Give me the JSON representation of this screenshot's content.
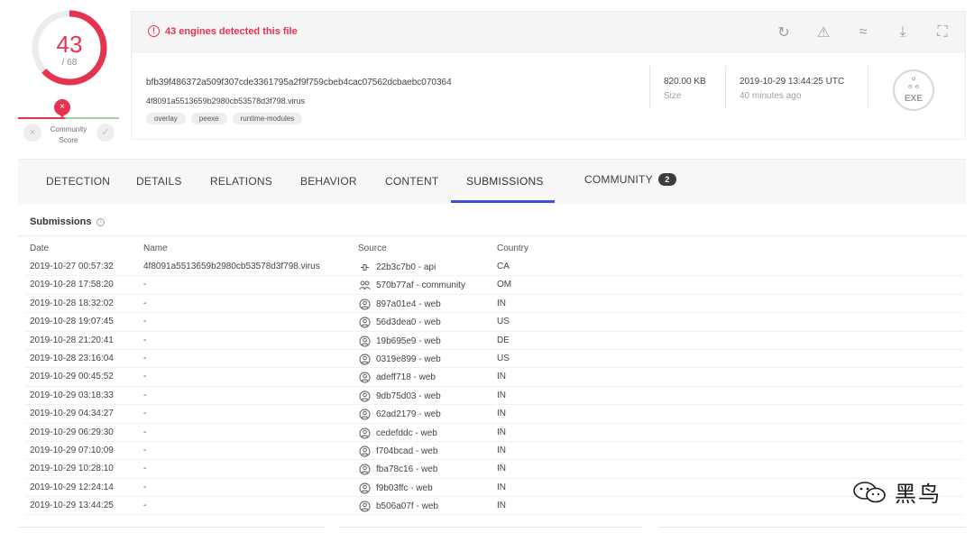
{
  "score": {
    "detected": "43",
    "total": "/ 68",
    "community_label_line1": "Community",
    "community_label_line2": "Score",
    "community_pin": "×",
    "dislike": "×",
    "like": "✓"
  },
  "alert": {
    "text": "43 engines detected this file",
    "icon": "!"
  },
  "tools": [
    {
      "name": "reanalyze-icon",
      "glyph": "↻"
    },
    {
      "name": "similar-icon",
      "glyph": "⚠"
    },
    {
      "name": "graph-icon",
      "glyph": "≈"
    },
    {
      "name": "download-icon",
      "glyph": "⤓"
    },
    {
      "name": "expand-icon",
      "glyph": "⛶"
    }
  ],
  "file": {
    "hash": "bfb39f486372a509f307cde3361795a2f9f759cbeb4cac07562dcbaebc070364",
    "name": "4f8091a5513659b2980cb53578d3f798.virus",
    "tags": [
      "overlay",
      "peexe",
      "runtime-modules"
    ],
    "size": "820.00 KB",
    "size_label": "Size",
    "date": "2019-10-29 13:44:25 UTC",
    "date_relative": "40 minutes ago",
    "type_icon_text": "EXE",
    "type_icon_glyph": "ஃ"
  },
  "tabs": [
    {
      "label": "DETECTION"
    },
    {
      "label": "DETAILS"
    },
    {
      "label": "RELATIONS"
    },
    {
      "label": "BEHAVIOR"
    },
    {
      "label": "CONTENT"
    },
    {
      "label": "SUBMISSIONS"
    },
    {
      "label": "COMMUNITY",
      "badge": "2"
    }
  ],
  "submissions": {
    "title": "Submissions",
    "info_icon": "i",
    "columns": {
      "date": "Date",
      "name": "Name",
      "source": "Source",
      "country": "Country"
    },
    "rows": [
      {
        "date": "2019-10-27 00:57:32",
        "name": "4f8091a5513659b2980cb53578d3f798.virus",
        "source": "22b3c7b0 - api",
        "type": "api",
        "country": "CA"
      },
      {
        "date": "2019-10-28 17:58:20",
        "name": "-",
        "source": "570b77af - community",
        "type": "community",
        "country": "OM"
      },
      {
        "date": "2019-10-28 18:32:02",
        "name": "-",
        "source": "897a01e4 - web",
        "type": "web",
        "country": "IN"
      },
      {
        "date": "2019-10-28 19:07:45",
        "name": "-",
        "source": "56d3dea0 - web",
        "type": "web",
        "country": "US"
      },
      {
        "date": "2019-10-28 21:20:41",
        "name": "-",
        "source": "19b695e9 - web",
        "type": "web",
        "country": "DE"
      },
      {
        "date": "2019-10-28 23:16:04",
        "name": "-",
        "source": "0319e899 - web",
        "type": "web",
        "country": "US"
      },
      {
        "date": "2019-10-29 00:45:52",
        "name": "-",
        "source": "adeff718 - web",
        "type": "web",
        "country": "IN"
      },
      {
        "date": "2019-10-29 03:18:33",
        "name": "-",
        "source": "9db75d03 - web",
        "type": "web",
        "country": "IN"
      },
      {
        "date": "2019-10-29 04:34:27",
        "name": "-",
        "source": "62ad2179 - web",
        "type": "web",
        "country": "IN"
      },
      {
        "date": "2019-10-29 06:29:30",
        "name": "-",
        "source": "cedefddc - web",
        "type": "web",
        "country": "IN"
      },
      {
        "date": "2019-10-29 07:10:09",
        "name": "-",
        "source": "f704bcad - web",
        "type": "web",
        "country": "IN"
      },
      {
        "date": "2019-10-29 10:28:10",
        "name": "-",
        "source": "fba78c16 - web",
        "type": "web",
        "country": "IN"
      },
      {
        "date": "2019-10-29 12:24:14",
        "name": "-",
        "source": "f9b03ffc - web",
        "type": "web",
        "country": "IN"
      },
      {
        "date": "2019-10-29 13:44:25",
        "name": "-",
        "source": "b506a07f - web",
        "type": "web",
        "country": "IN"
      }
    ]
  },
  "watermark": {
    "text": "黑鸟"
  },
  "colors": {
    "accent": "#3f51d3",
    "danger": "#e6334f",
    "safe": "#9fd1a7"
  }
}
